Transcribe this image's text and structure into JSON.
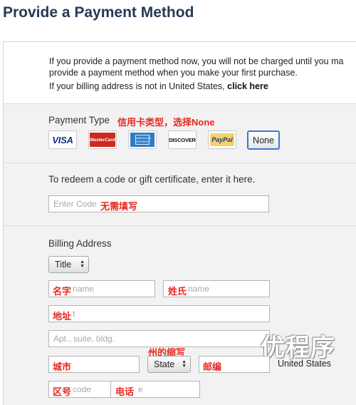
{
  "page": {
    "title": "Provide a Payment Method"
  },
  "notice": {
    "line1": "If you provide a payment method now, you will not be charged until you ma",
    "line2": "provide a payment method when you make your first purchase.",
    "line3_prefix": "If your billing address is not in United States, ",
    "line3_link": "click here"
  },
  "payment": {
    "label": "Payment Type",
    "annotation": "信用卡类型，选择None",
    "cards": [
      {
        "name": "visa",
        "text": "VISA"
      },
      {
        "name": "mastercard",
        "text": "MasterCard"
      },
      {
        "name": "amex",
        "text": "AMERICAN EXPRESS"
      },
      {
        "name": "discover",
        "text": "DISCOVER"
      },
      {
        "name": "paypal",
        "text": "PayPal"
      }
    ],
    "none_label": "None"
  },
  "redeem": {
    "label": "To redeem a code or gift certificate, enter it here.",
    "placeholder": "Enter Code",
    "annotation": "无需填写"
  },
  "billing": {
    "label": "Billing Address",
    "title_select": "Title",
    "first_name": {
      "placeholder": "name",
      "annotation": "名字"
    },
    "last_name": {
      "placeholder": "name",
      "annotation": "姓氏"
    },
    "street": {
      "placeholder": "t",
      "annotation": "地址"
    },
    "apt": {
      "placeholder": "Apt., suite, bldg."
    },
    "city": {
      "annotation": "城市"
    },
    "state_select": "State",
    "state_annotation": "州的缩写",
    "zip": {
      "annotation": "邮编"
    },
    "country": "United States",
    "area_code": {
      "placeholder": "code",
      "annotation": "区号"
    },
    "phone": {
      "placeholder": "e",
      "annotation": "电话"
    }
  },
  "watermark": "优程序",
  "colors": {
    "title": "#253a55",
    "annotation": "#e8281e",
    "focus": "#3a78d6"
  }
}
